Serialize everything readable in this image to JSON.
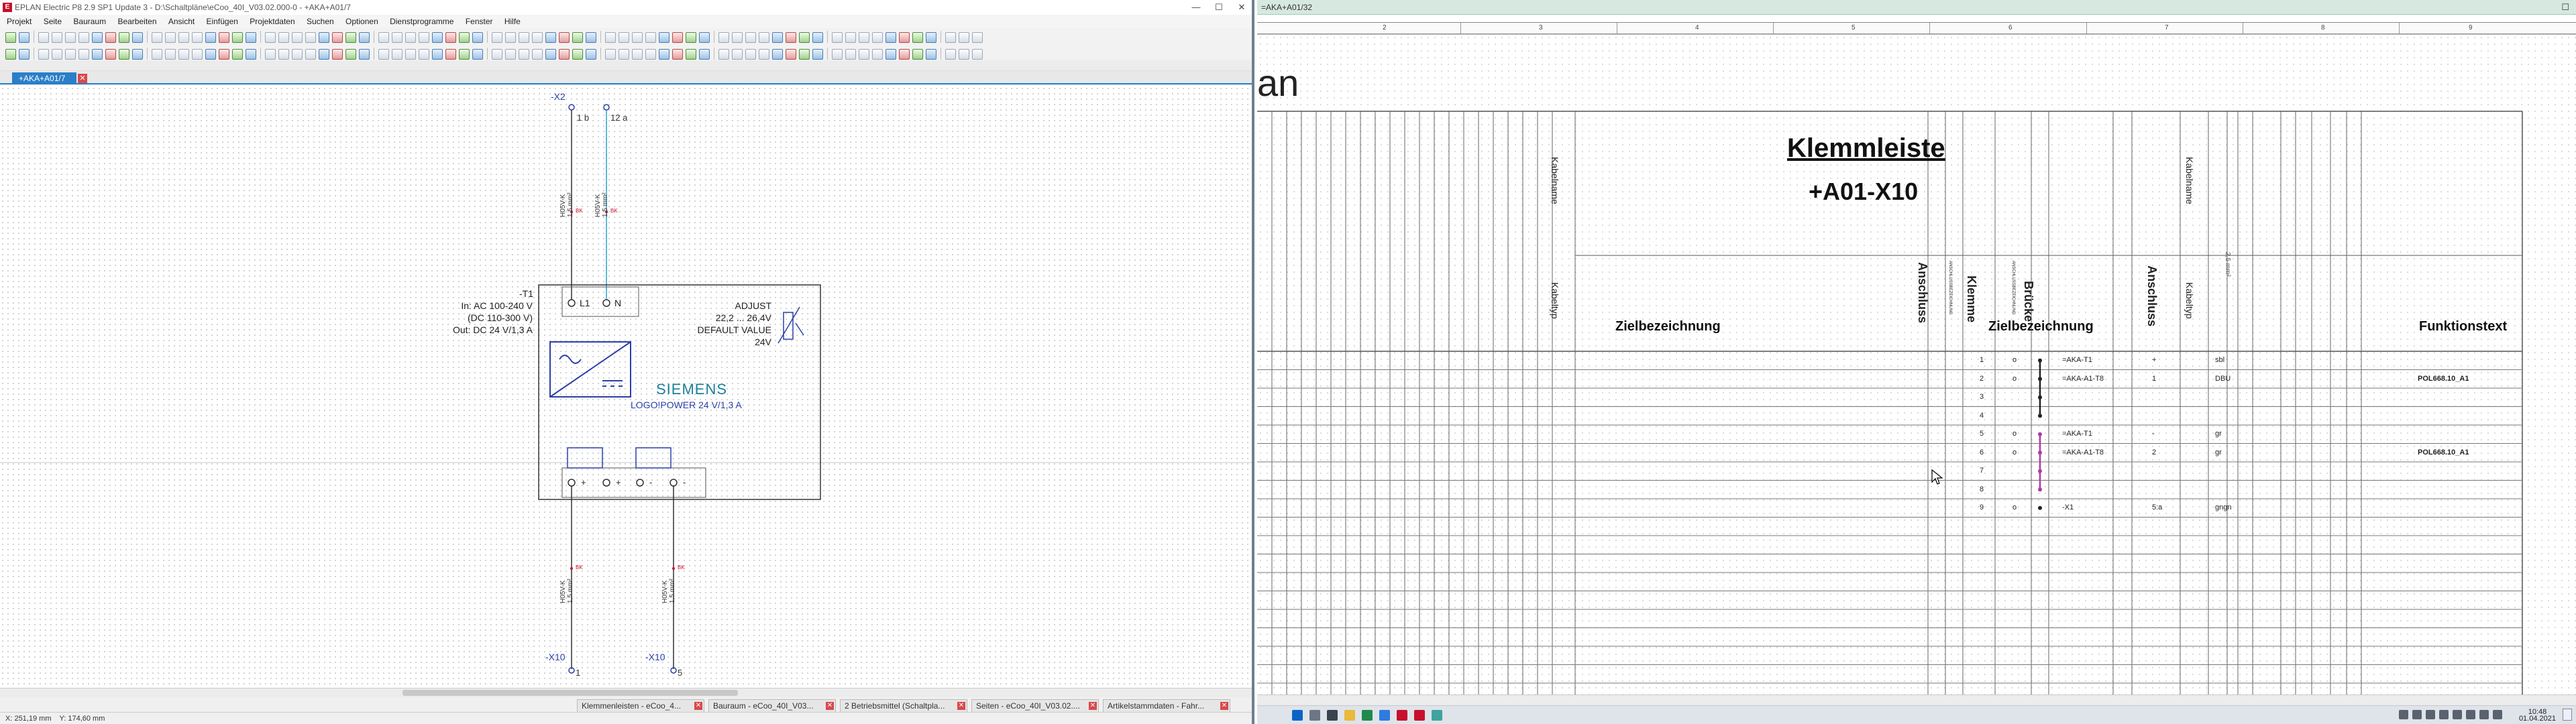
{
  "left_window": {
    "title": "EPLAN Electric P8 2.9 SP1 Update 3 - D:\\Schaltpläne\\eCoo_40I_V03.02.000-0 - +AKA+A01/7",
    "menu": [
      "Projekt",
      "Seite",
      "Bauraum",
      "Bearbeiten",
      "Ansicht",
      "Einfügen",
      "Projektdaten",
      "Suchen",
      "Optionen",
      "Dienstprogramme",
      "Fenster",
      "Hilfe"
    ],
    "tab_label": "+AKA+A01/7",
    "status_x": "X: 251,19 mm",
    "status_y": "Y: 174,60 mm",
    "bottom_tabs": [
      "Klemmenleisten - eCoo_4...",
      "Bauraum - eCoo_40I_V03...",
      "2 Betriebsmittel (Schaltpla...",
      "Seiten - eCoo_40I_V03.02....",
      "Artikelstammdaten - Fahr..."
    ]
  },
  "schematic": {
    "x2_label": "-X2",
    "x2_term_1": "1 b",
    "x2_term_2": "12 a",
    "cable_1": "H05V-K\n1,5 mm²",
    "cable_2": "H05V-K\n1,5 mm²",
    "cable_3": "H05V-K\n1,5 mm²",
    "cable_4": "H05V-K\n1,5 mm²",
    "wire_tag": "BK",
    "device_tag": "-T1",
    "spec_in": "In: AC 100-240 V",
    "spec_dc": "(DC 110-300 V)",
    "spec_out": "Out: DC 24 V/1,3 A",
    "pin_l1": "L1",
    "pin_n": "N",
    "adjust_1": "ADJUST",
    "adjust_2": "22,2 ... 26,4V",
    "adjust_3": "DEFAULT VALUE",
    "adjust_4": "24V",
    "brand": "SIEMENS",
    "product": "LOGO!POWER 24 V/1,3 A",
    "out_plus_1": "+",
    "out_plus_2": "+",
    "out_minus_1": "-",
    "out_minus_2": "-",
    "x10_a": "-X10",
    "x10_a_term": "1",
    "x10_b": "-X10",
    "x10_b_term": "5"
  },
  "right_window": {
    "title": "=AKA+A01/32",
    "ruler": [
      "2",
      "3",
      "4",
      "5",
      "6",
      "7",
      "8",
      "9"
    ],
    "heading_fragment": "an",
    "title_main": "Klemmleiste",
    "title_sub": "+A01-X10",
    "hdr_kabelname_left": "Kabelname",
    "hdr_kabeltyp_left": "Kabeltyp",
    "hdr_zielbezeichnung_left": "Zielbezeichnung",
    "hdr_anschluss_left": "Anschluss",
    "hdr_small_1": "ANSCHLUSSBEZEICHNUNG",
    "hdr_small_2": "ANSCHLUSSBEZEICHNUNG",
    "hdr_klemme": "Klemme",
    "hdr_bruecke": "Brücke",
    "hdr_zielbezeichnung_right": "Zielbezeichnung",
    "hdr_anschluss_right": "Anschluss",
    "hdr_kabelname_right": "Kabelname",
    "hdr_kabeltyp_right": "Kabeltyp",
    "hdr_mm2": "2,5 mm²",
    "hdr_funktionstext": "Funktionstext",
    "rows": [
      {
        "klemme": "1",
        "sym": "o",
        "ziel": "=AKA-T1",
        "ans": "+",
        "farbe": "sbl",
        "funktion": ""
      },
      {
        "klemme": "2",
        "sym": "o",
        "ziel": "=AKA-A1-T8",
        "ans": "1",
        "farbe": "DBU",
        "funktion": "POL668.10_A1"
      },
      {
        "klemme": "3",
        "sym": "",
        "ziel": "",
        "ans": "",
        "farbe": "",
        "funktion": ""
      },
      {
        "klemme": "4",
        "sym": "",
        "ziel": "",
        "ans": "",
        "farbe": "",
        "funktion": ""
      },
      {
        "klemme": "5",
        "sym": "o",
        "ziel": "=AKA-T1",
        "ans": "-",
        "farbe": "gr",
        "funktion": ""
      },
      {
        "klemme": "6",
        "sym": "o",
        "ziel": "=AKA-A1-T8",
        "ans": "2",
        "farbe": "gr",
        "funktion": "POL668.10_A1"
      },
      {
        "klemme": "7",
        "sym": "",
        "ziel": "",
        "ans": "",
        "farbe": "",
        "funktion": ""
      },
      {
        "klemme": "8",
        "sym": "",
        "ziel": "",
        "ans": "",
        "farbe": "",
        "funktion": ""
      },
      {
        "klemme": "9",
        "sym": "o",
        "ziel": "-X1",
        "ans": "5:a",
        "farbe": "gngn",
        "funktion": ""
      }
    ]
  },
  "taskbar": {
    "time": "10:48",
    "date": "01.04.2021"
  },
  "colors": {
    "accent": "#2a7fc8",
    "wire_black": "#333333",
    "wire_blue": "#2aa0c8",
    "schematic_blue": "#2b3fa8",
    "siemens_teal": "#1d7f9a",
    "bridge_magenta": "#b03aa8"
  }
}
